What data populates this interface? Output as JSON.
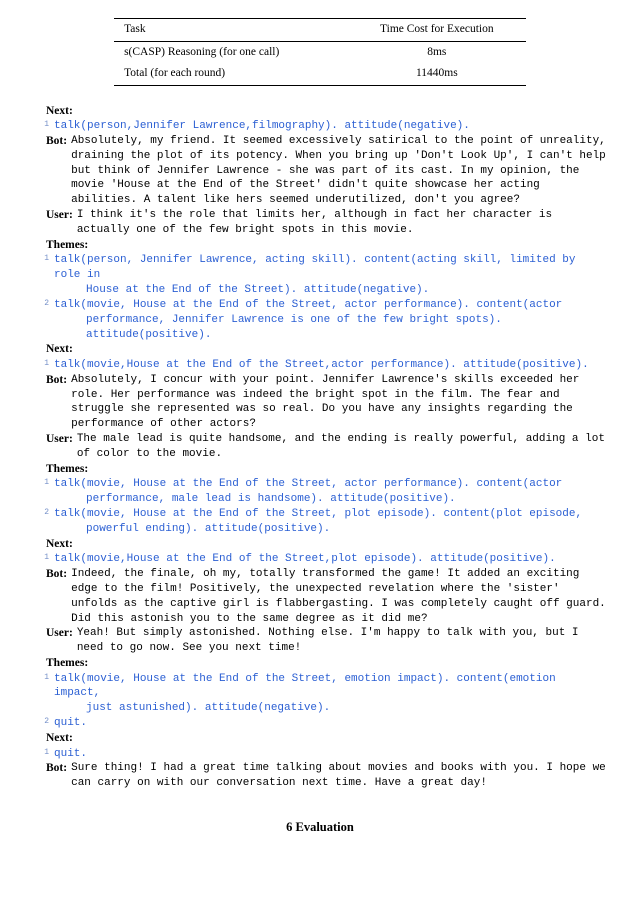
{
  "table": {
    "header_task": "Task",
    "header_time": "Time Cost for Execution",
    "rows": [
      {
        "task": "s(CASP) Reasoning (for one call)",
        "time": "8ms"
      },
      {
        "task": "Total (for each round)",
        "time": "11440ms"
      }
    ]
  },
  "labels": {
    "next": "Next:",
    "themes": "Themes:",
    "bot": "Bot:",
    "user": "User:"
  },
  "turns": [
    {
      "type": "next",
      "lines": [
        "talk(person,Jennifer Lawrence,filmography). attitude(negative)."
      ]
    },
    {
      "type": "bot",
      "text": "Absolutely, my friend. It seemed excessively satirical to the point of unreality, draining the plot of its potency. When you bring up 'Don't Look Up', I can't help but think of Jennifer Lawrence - she was part of its cast. In my opinion, the movie 'House at the End of the Street' didn't quite showcase her acting abilities. A talent like hers seemed underutilized, don't you agree?"
    },
    {
      "type": "user",
      "text": "I think it's the role that limits her, although in fact her character is actually one of the few bright spots in this movie."
    },
    {
      "type": "themes",
      "lines": [
        "talk(person, Jennifer Lawrence, acting skill). content(acting skill, limited by role in House at the End of the Street). attitude(negative).",
        "talk(movie, House at the End of the Street, actor performance). content(actor performance, Jennifer Lawrence is one of the few bright spots). attitude(positive)."
      ]
    },
    {
      "type": "next",
      "lines": [
        "talk(movie,House at the End of the Street,actor performance). attitude(positive)."
      ]
    },
    {
      "type": "bot",
      "text": "Absolutely, I concur with your point. Jennifer Lawrence's skills exceeded her role. Her performance was indeed the bright spot in the film. The fear and struggle she represented was so real. Do you have any insights regarding the performance of other actors?"
    },
    {
      "type": "user",
      "text": "The male lead is quite handsome, and the ending is really powerful, adding a lot of color to the movie."
    },
    {
      "type": "themes",
      "lines": [
        "talk(movie, House at the End of the Street, actor performance). content(actor performance, male lead is handsome). attitude(positive).",
        "talk(movie, House at the End of the Street, plot episode). content(plot episode, powerful ending). attitude(positive)."
      ]
    },
    {
      "type": "next",
      "lines": [
        "talk(movie,House at the End of the Street,plot episode). attitude(positive)."
      ]
    },
    {
      "type": "bot",
      "text": "Indeed, the finale, oh my, totally transformed the game! It added an exciting edge to the film! Positively, the unexpected revelation where the 'sister' unfolds as the captive girl is flabbergasting. I was completely caught off guard. Did this astonish you to the same degree as it did me?"
    },
    {
      "type": "user",
      "text": "Yeah! But simply astonished. Nothing else. I'm happy to talk with you, but I need to go now. See you next time!"
    },
    {
      "type": "themes",
      "lines": [
        "talk(movie, House at the End of the Street, emotion impact). content(emotion impact, just astunished). attitude(negative).",
        "quit."
      ]
    },
    {
      "type": "next",
      "lines": [
        "quit."
      ]
    },
    {
      "type": "bot",
      "text": "Sure thing! I had a great time talking about movies and books with you. I hope we can carry on with our conversation next time. Have a great day!"
    }
  ],
  "heading": "6  Evaluation"
}
